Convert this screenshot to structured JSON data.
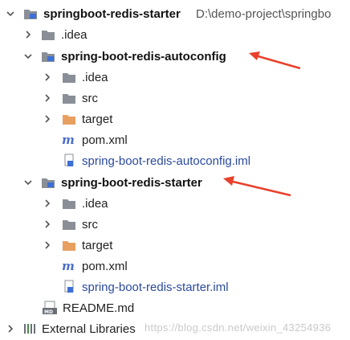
{
  "tree": {
    "root": {
      "name": "springboot-redis-starter",
      "path": "D:\\demo-project\\springbo",
      "arrow": "expanded",
      "icon": "module-folder-icon"
    },
    "root_idea": {
      "name": ".idea"
    },
    "autoconfig": {
      "name": "spring-boot-redis-autoconfig",
      "children": {
        "idea": ".idea",
        "src": "src",
        "target": "target",
        "pom": "pom.xml",
        "iml": "spring-boot-redis-autoconfig.iml"
      }
    },
    "starter": {
      "name": "spring-boot-redis-starter",
      "children": {
        "idea": ".idea",
        "src": "src",
        "target": "target",
        "pom": "pom.xml",
        "iml": "spring-boot-redis-starter.iml"
      }
    },
    "readme": "README.md",
    "external": "External Libraries"
  },
  "annotations": {
    "arrow_color": "#e8412c"
  },
  "watermark": "https://blog.csdn.net/weixin_43254936",
  "colors": {
    "folder": "#8a8f97",
    "target_folder": "#e8a060",
    "pom_m": "#4a6fc9",
    "iml_text": "#2a4a9e"
  }
}
